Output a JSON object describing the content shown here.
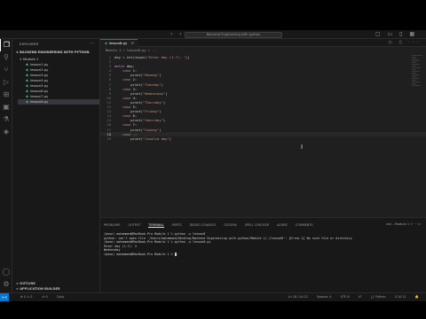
{
  "titlebar": {
    "search_label": "Backend Engineering with python"
  },
  "sidebar": {
    "title": "EXPLORER",
    "more": "···",
    "project": "BACKEND ENGINEERING WITH PYTHON",
    "folder": "Module 1",
    "files": [
      "lesson1.py",
      "lesson2.py",
      "lesson3.py",
      "lesson4.py",
      "lesson5.py",
      "lesson6.py",
      "lesson7.py",
      "lesson8.py"
    ],
    "outline": "OUTLINE",
    "timeline": "APPLICATION BUILDER"
  },
  "editor": {
    "active_tab": "lesson8.py",
    "breadcrumb": "Module 1 > lesson8.py > ...",
    "code_lines": [
      {
        "n": "1",
        "text": "day = int(input(\"Enter day (1-7): \"))"
      },
      {
        "n": "2",
        "text": ""
      },
      {
        "n": "3",
        "text": "match day:"
      },
      {
        "n": "4",
        "text": "    case 1:"
      },
      {
        "n": "5",
        "text": "        print(\"Monday\")"
      },
      {
        "n": "6",
        "text": "    case 2:"
      },
      {
        "n": "7",
        "text": "        print(\"Tuesday\")"
      },
      {
        "n": "8",
        "text": "    case 3:"
      },
      {
        "n": "9",
        "text": "        print(\"Wednesday\")"
      },
      {
        "n": "10",
        "text": "    case 4:"
      },
      {
        "n": "11",
        "text": "        print(\"Thursday\")"
      },
      {
        "n": "12",
        "text": "    case 5:"
      },
      {
        "n": "13",
        "text": "        print(\"Friday\")"
      },
      {
        "n": "14",
        "text": "    case 6:"
      },
      {
        "n": "15",
        "text": "        print(\"Saturday\")"
      },
      {
        "n": "16",
        "text": "    case 7:"
      },
      {
        "n": "17",
        "text": "        print(\"Sunday\")"
      },
      {
        "n": "18",
        "text": "    case _:"
      },
      {
        "n": "19",
        "text": "        print(\"Invalid day\")"
      }
    ],
    "current_line": "18"
  },
  "panel": {
    "tabs": [
      "PROBLEMS",
      "OUTPUT",
      "TERMINAL",
      "PORTS",
      "DEBUG CONSOLE",
      "GITLENS",
      "SPELL CHECKER",
      "AZURE",
      "COMMENTS"
    ],
    "active_tab": "TERMINAL",
    "terminal_actions": "zsh - Module 1  +  ···  ×",
    "terminal_lines": [
      "(base) mohammed@MacBook-Pro Module 1 % python -u lesson8",
      "python: can't open file '/Users/mohammed/Desktop/Backend Engineering with python/Module 1/./lesson8': [Errno 2] No such file or directory",
      "(base) mohammed@MacBook-Pro Module 1 % python -u lesson8.py",
      "Enter day (1-7): 3",
      "Wednesday",
      "(base) mohammed@MacBook-Pro Module 1 % "
    ]
  },
  "statusbar": {
    "remote": "><",
    "left_items": [
      "⊗ 0 ⚠ 0",
      "⎇ 0",
      "Cody"
    ],
    "right_items": [
      "Ln 18, Col 12",
      "Spaces: 4",
      "UTF-8",
      "LF",
      "{} Python",
      "3.10.11",
      "🔔"
    ]
  }
}
